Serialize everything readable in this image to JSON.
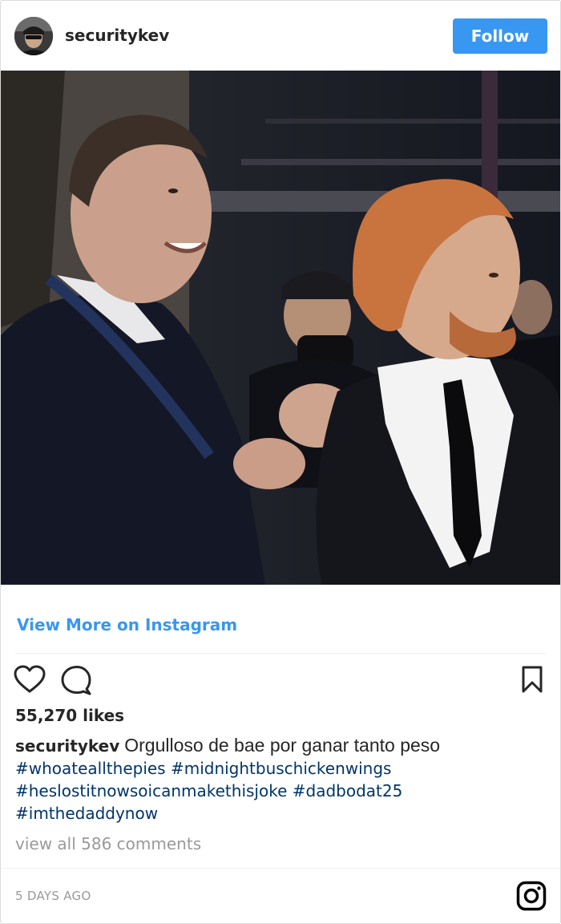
{
  "header": {
    "username": "securitykev",
    "follow_label": "Follow",
    "avatar_icon": "profile-avatar"
  },
  "post": {
    "image_description": "",
    "view_more_label": "View More on Instagram",
    "likes": "55,270 likes",
    "caption": {
      "username": "securitykev",
      "text": "Orgulloso de bae por ganar tanto peso",
      "hashtags_line1": "#whoateallthepies #midnightbuschickenwings",
      "hashtags_line2": "#heslostitnowsoicanmakethisjoke #dadbodat25",
      "hashtags_line3": "#imthedaddynow"
    },
    "comments_link": "view all 586 comments",
    "timestamp": "5 DAYS AGO"
  },
  "icons": {
    "like": "heart-icon",
    "comment": "comment-bubble-icon",
    "save": "bookmark-icon",
    "brand": "instagram-logo-icon"
  },
  "colors": {
    "accent": "#3897f0",
    "hashtag": "#003569",
    "muted": "#999999"
  }
}
